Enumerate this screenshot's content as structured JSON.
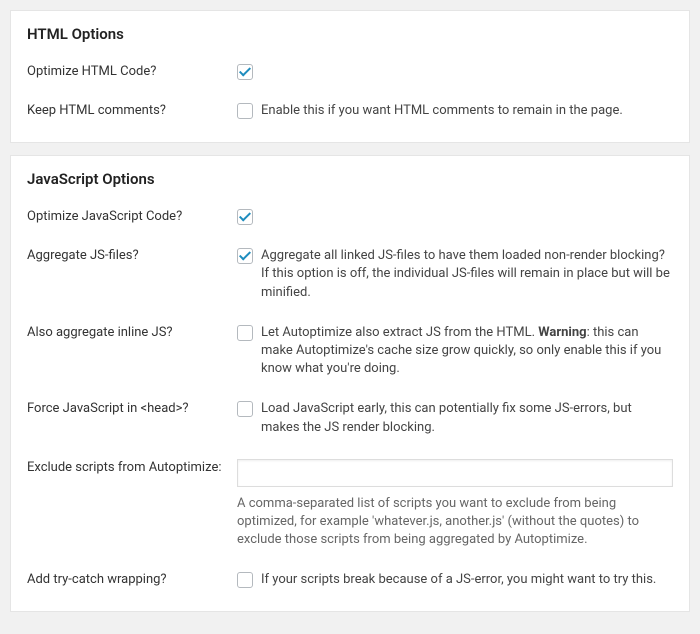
{
  "html_options": {
    "title": "HTML Options",
    "optimize_html": {
      "label": "Optimize HTML Code?",
      "checked": true
    },
    "keep_comments": {
      "label": "Keep HTML comments?",
      "checked": false,
      "description": "Enable this if you want HTML comments to remain in the page."
    }
  },
  "js_options": {
    "title": "JavaScript Options",
    "optimize_js": {
      "label": "Optimize JavaScript Code?",
      "checked": true
    },
    "aggregate_js": {
      "label": "Aggregate JS-files?",
      "checked": true,
      "description": "Aggregate all linked JS-files to have them loaded non-render blocking? If this option is off, the individual JS-files will remain in place but will be minified."
    },
    "aggregate_inline_js": {
      "label": "Also aggregate inline JS?",
      "checked": false,
      "desc_prefix": "Let Autoptimize also extract JS from the HTML. ",
      "desc_warning": "Warning",
      "desc_suffix": ": this can make Autoptimize's cache size grow quickly, so only enable this if you know what you're doing."
    },
    "force_head": {
      "label": "Force JavaScript in <head>?",
      "checked": false,
      "description": "Load JavaScript early, this can potentially fix some JS-errors, but makes the JS render blocking."
    },
    "exclude_scripts": {
      "label": "Exclude scripts from Autoptimize:",
      "value": "",
      "help": "A comma-separated list of scripts you want to exclude from being optimized, for example 'whatever.js, another.js' (without the quotes) to exclude those scripts from being aggregated by Autoptimize."
    },
    "try_catch": {
      "label": "Add try-catch wrapping?",
      "checked": false,
      "description": "If your scripts break because of a JS-error, you might want to try this."
    }
  }
}
